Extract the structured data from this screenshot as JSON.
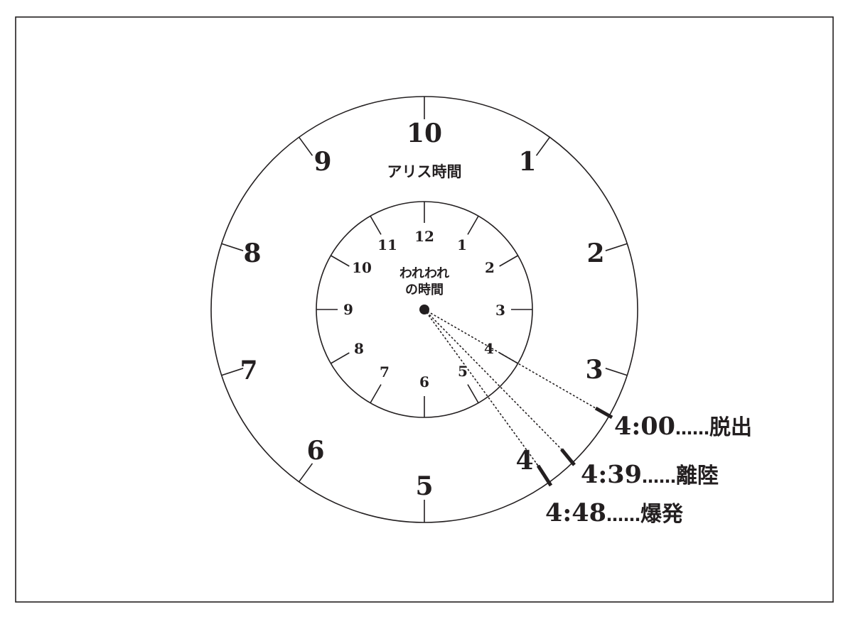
{
  "outer_dial": {
    "caption": "アリス時間",
    "numbers": [
      "10",
      "1",
      "2",
      "3",
      "4",
      "5",
      "6",
      "7",
      "8",
      "9"
    ]
  },
  "inner_dial": {
    "caption_line1": "われわれ",
    "caption_line2": "の時間",
    "numbers": [
      "12",
      "1",
      "2",
      "3",
      "4",
      "5",
      "6",
      "7",
      "8",
      "9",
      "10",
      "11"
    ]
  },
  "events": [
    {
      "time": "4:00",
      "dots": "……",
      "label": "脱出"
    },
    {
      "time": "4:39",
      "dots": "……",
      "label": "離陸"
    },
    {
      "time": "4:48",
      "dots": "……",
      "label": "爆発"
    }
  ],
  "colors": {
    "ink": "#231f20",
    "background": "#ffffff"
  }
}
